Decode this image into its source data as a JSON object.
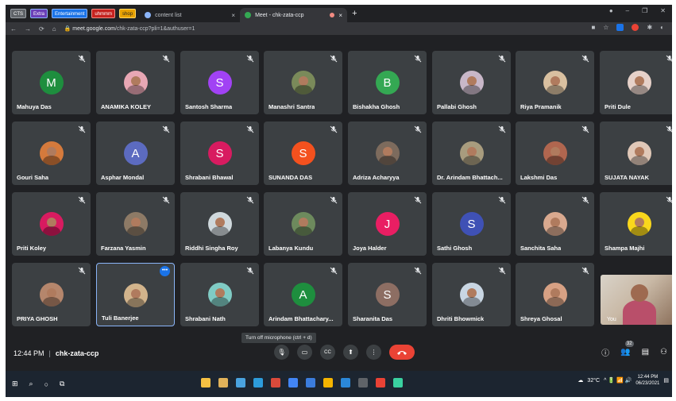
{
  "browser": {
    "bookmarks": [
      {
        "label": "CTS",
        "border": "#9aa0a6",
        "bg": "#5f6368",
        "color": "#ffffff"
      },
      {
        "label": "Extra",
        "border": "#8ab4f8",
        "bg": "#6a3fb8",
        "color": "#ffffff"
      },
      {
        "label": "Entertainment",
        "border": "#8ab4f8",
        "bg": "#1a73e8",
        "color": "#ffffff"
      },
      {
        "label": "uhmmm",
        "border": "#f28b82",
        "bg": "#c5221f",
        "color": "#ffffff"
      },
      {
        "label": "shop",
        "border": "#fdd663",
        "bg": "#e8a202",
        "color": "#202124"
      }
    ],
    "tabs": [
      {
        "title": "content list",
        "close": "×"
      },
      {
        "title": "Meet - chk-zata-ccp",
        "close": "×"
      }
    ],
    "new_tab": "+",
    "window_controls": [
      "●",
      "–",
      "❐",
      "✕"
    ],
    "url_host": "meet.google.com",
    "url_path": "/chk-zata-ccp?pli=1&authuser=1",
    "nav_icons": [
      "←",
      "→",
      "⟳",
      "⌂"
    ]
  },
  "participants": [
    {
      "name": "Mahuya Das",
      "initial": "M",
      "color": "#1e8e3e",
      "photo": false
    },
    {
      "name": "ANAMIKA KOLEY",
      "initial": "",
      "color": "#e8a7b4",
      "photo": true
    },
    {
      "name": "Santosh Sharma",
      "initial": "S",
      "color": "#a142f4",
      "photo": false
    },
    {
      "name": "Manashri Santra",
      "initial": "",
      "color": "#7a8a5a",
      "photo": true
    },
    {
      "name": "Bishakha Ghosh",
      "initial": "B",
      "color": "#34a853",
      "photo": false
    },
    {
      "name": "Pallabi Ghosh",
      "initial": "",
      "color": "#c8b7c8",
      "photo": true
    },
    {
      "name": "Riya Pramanik",
      "initial": "",
      "color": "#d9c0a0",
      "photo": true
    },
    {
      "name": "Priti Dule",
      "initial": "",
      "color": "#e6d1c9",
      "photo": true
    },
    {
      "name": "Gouri Saha",
      "initial": "",
      "color": "#d57a3c",
      "photo": true
    },
    {
      "name": "Asphar Mondal",
      "initial": "A",
      "color": "#5c6bc0",
      "photo": false
    },
    {
      "name": "Shrabani Bhawal",
      "initial": "S",
      "color": "#d81b60",
      "photo": false
    },
    {
      "name": "SUNANDA DAS",
      "initial": "S",
      "color": "#f4511e",
      "photo": false
    },
    {
      "name": "Adriza Acharyya",
      "initial": "",
      "color": "#7d6b5d",
      "photo": true
    },
    {
      "name": "Dr. Arindam Bhattach...",
      "initial": "",
      "color": "#a89c7e",
      "photo": true
    },
    {
      "name": "Lakshmi Das",
      "initial": "",
      "color": "#b0664f",
      "photo": true
    },
    {
      "name": "SUJATA NAYAK",
      "initial": "",
      "color": "#e0c8b8",
      "photo": true
    },
    {
      "name": "Priti Koley",
      "initial": "",
      "color": "#d81b60",
      "photo": true
    },
    {
      "name": "Farzana Yasmin",
      "initial": "",
      "color": "#8d7a66",
      "photo": true
    },
    {
      "name": "Riddhi Singha Roy",
      "initial": "",
      "color": "#cfd8dc",
      "photo": true
    },
    {
      "name": "Labanya Kundu",
      "initial": "",
      "color": "#6d8a5d",
      "photo": true
    },
    {
      "name": "Joya Halder",
      "initial": "J",
      "color": "#e91e63",
      "photo": false
    },
    {
      "name": "Sathi Ghosh",
      "initial": "S",
      "color": "#3f51b5",
      "photo": false
    },
    {
      "name": "Sanchita Saha",
      "initial": "",
      "color": "#d9a98f",
      "photo": true
    },
    {
      "name": "Shampa Majhi",
      "initial": "",
      "color": "#f9d71c",
      "photo": true
    },
    {
      "name": "PRIYA GHOSH",
      "initial": "",
      "color": "#b5866c",
      "photo": true
    },
    {
      "name": "Tuli Banerjee",
      "initial": "",
      "color": "#d2b48c",
      "photo": true
    },
    {
      "name": "Shrabani Nath",
      "initial": "",
      "color": "#80cbc4",
      "photo": true
    },
    {
      "name": "Arindam Bhattachary...",
      "initial": "A",
      "color": "#1e8e3e",
      "photo": false
    },
    {
      "name": "Sharanita Das",
      "initial": "S",
      "color": "#8d6e63",
      "photo": false
    },
    {
      "name": "Dhriti Bhowmick",
      "initial": "",
      "color": "#c9d6e3",
      "photo": true
    },
    {
      "name": "Shreya Ghosal",
      "initial": "",
      "color": "#d7a184",
      "photo": true
    }
  ],
  "self_view": {
    "name": "You"
  },
  "meeting": {
    "time": "12:44 PM",
    "separator": "|",
    "code": "chk-zata-ccp"
  },
  "tooltip": "Turn off microphone (ctrl + d)",
  "controls": [
    {
      "icon": "🎙"
    },
    {
      "icon": "▭"
    },
    {
      "icon": "CC"
    },
    {
      "icon": "⬆"
    },
    {
      "icon": "⋮"
    }
  ],
  "end_call_color": "#ea4335",
  "right_controls": {
    "info": "ⓘ",
    "people": "👥",
    "people_count": "32",
    "chat": "▤",
    "activities": "⚇"
  },
  "taskbar": {
    "start": "⊞",
    "search": "⌕",
    "cortana": "○",
    "task_view": "⧉",
    "apps": [
      "#f6c143",
      "#e0b25a",
      "#4aa3df",
      "#2d9cdb",
      "#d94a3b",
      "#4285f4",
      "#3b7ddd",
      "#f4b400",
      "#2b88d8",
      "#5f6368",
      "#e94235",
      "#3ad1a0"
    ],
    "weather": "32°C",
    "tray_icons": "^ 🔋 📶 🔊",
    "time": "12:44 PM",
    "date": "06/23/2021"
  }
}
